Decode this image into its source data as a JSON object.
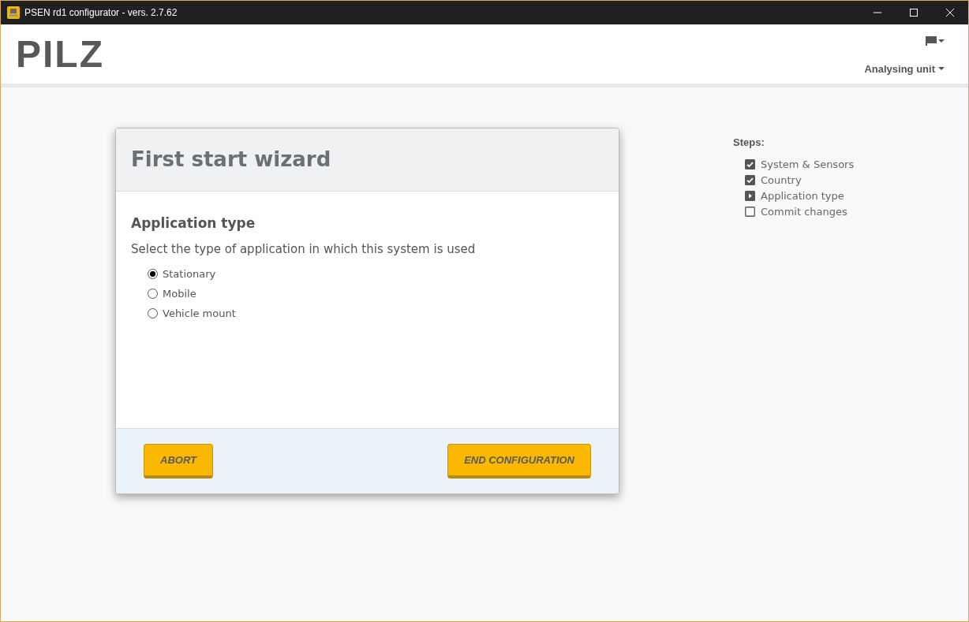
{
  "window": {
    "title": "PSEN rd1 configurator - vers. 2.7.62"
  },
  "header": {
    "logo": "PILZ",
    "menu": "Analysing unit"
  },
  "dialog": {
    "title": "First start wizard",
    "heading": "Application type",
    "description": "Select the type of application in which this system is used",
    "options": [
      {
        "label": "Stationary",
        "selected": true
      },
      {
        "label": "Mobile",
        "selected": false
      },
      {
        "label": "Vehicle mount",
        "selected": false
      }
    ],
    "buttons": [
      "ABORT",
      "END CONFIGURATION"
    ]
  },
  "steps": {
    "title": "Steps:",
    "items": [
      {
        "label": "System & Sensors",
        "checked": true,
        "current": false
      },
      {
        "label": "Country",
        "checked": true,
        "current": false
      },
      {
        "label": "Application type",
        "checked": false,
        "current": true
      },
      {
        "label": "Commit changes",
        "checked": false,
        "current": false
      }
    ]
  }
}
